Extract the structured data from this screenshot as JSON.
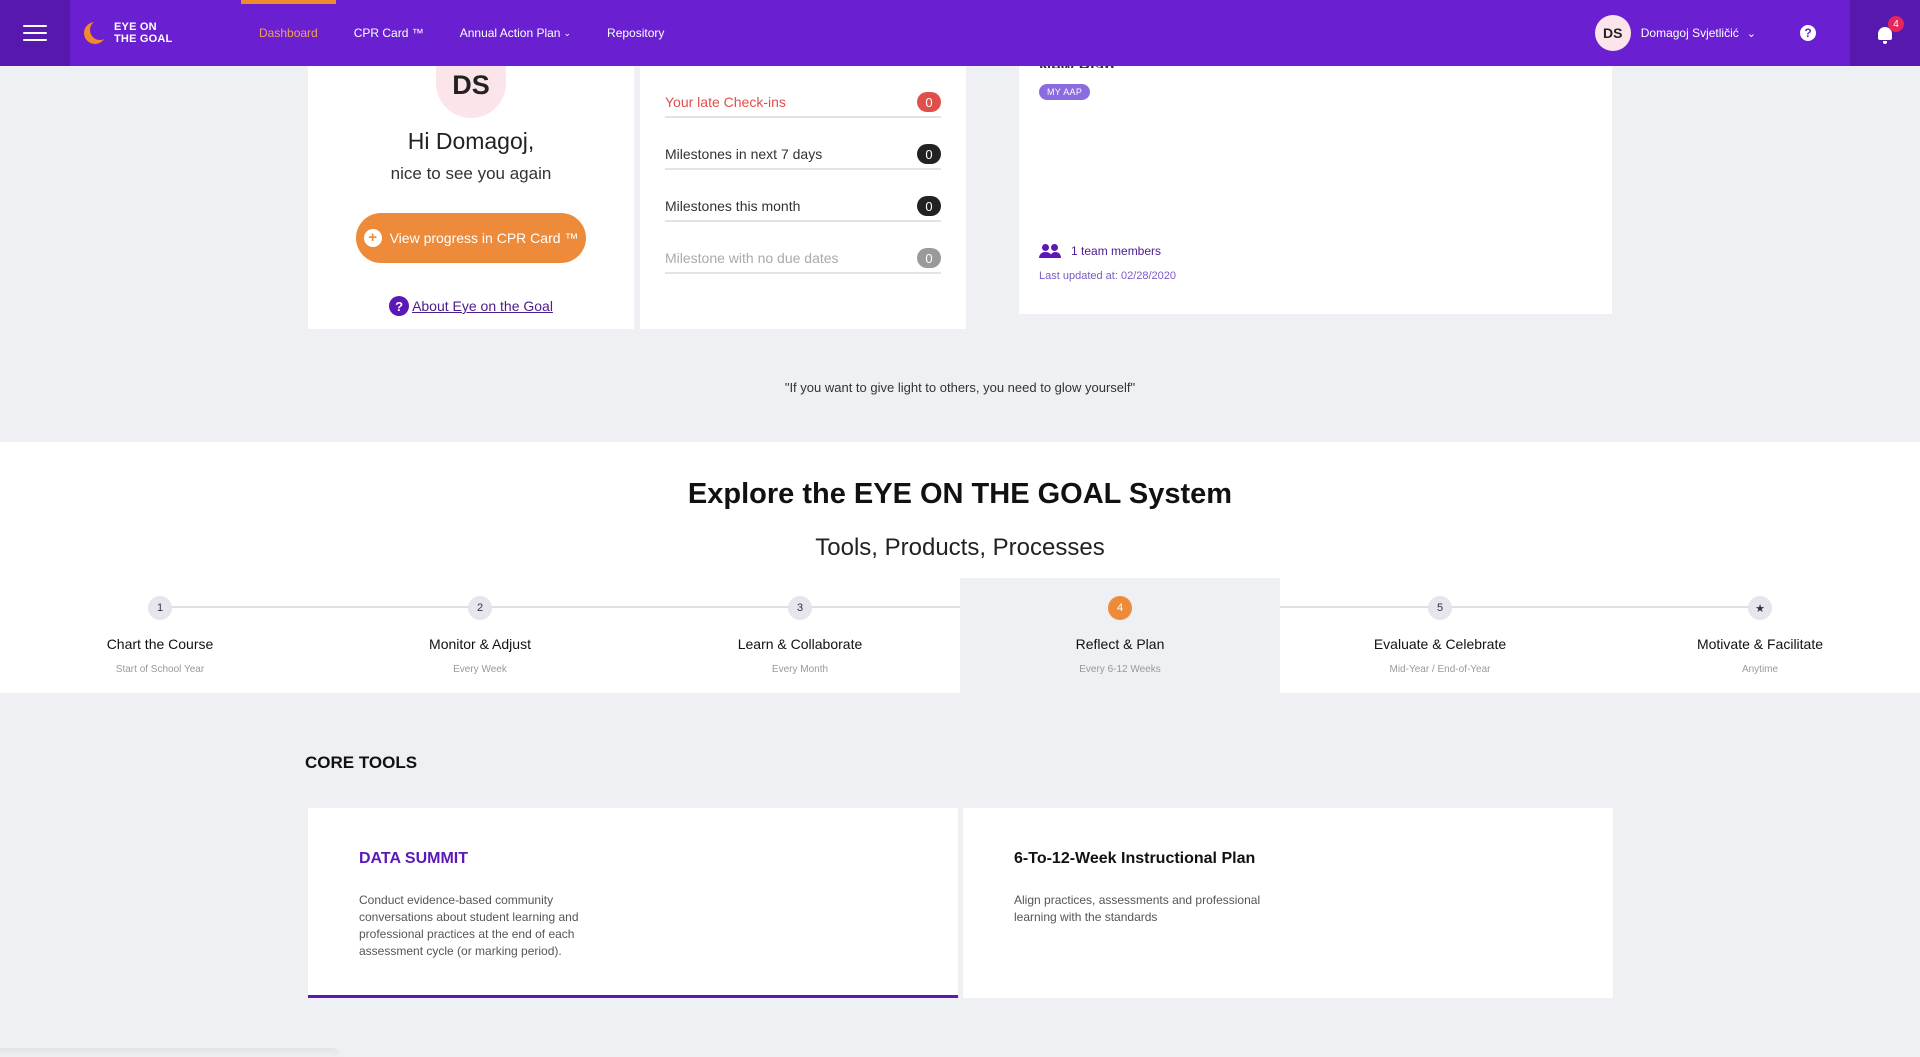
{
  "app": {
    "logo_line1": "EYE ON",
    "logo_line2": "THE GOAL"
  },
  "nav": {
    "items": [
      {
        "label": "Dashboard",
        "dropdown": false
      },
      {
        "label": "CPR Card ™",
        "dropdown": false
      },
      {
        "label": "Annual Action Plan",
        "dropdown": true
      },
      {
        "label": "Repository",
        "dropdown": false
      }
    ],
    "user_initials": "DS",
    "user_name": "Domagoj Svjetličić",
    "notification_count": "4"
  },
  "profile": {
    "initials": "DS",
    "greeting": "Hi Domagoj,",
    "greeting_sub": "nice to see you again",
    "cpr_button_label": "View progress in CPR Card ™",
    "about_link": "About Eye on the Goal"
  },
  "milestones": [
    {
      "label": "Your late Check-ins",
      "count": "0"
    },
    {
      "label": "Milestones in next 7 days",
      "count": "0"
    },
    {
      "label": "Milestones this month",
      "count": "0"
    },
    {
      "label": "Milestone with no due dates",
      "count": "0"
    }
  ],
  "plan": {
    "title": "New Plan",
    "tag": "MY AAP",
    "team_members": "1 team members",
    "last_updated": "Last updated at: 02/28/2020"
  },
  "quote": "\"If you want to give light to others, you need to glow yourself\"",
  "explore": {
    "title": "Explore the EYE ON THE GOAL System",
    "subtitle": "Tools, Products, Processes",
    "steps": [
      {
        "marker": "1",
        "name": "Chart the Course",
        "when": "Start of School Year"
      },
      {
        "marker": "2",
        "name": "Monitor & Adjust",
        "when": "Every Week"
      },
      {
        "marker": "3",
        "name": "Learn & Collaborate",
        "when": "Every Month"
      },
      {
        "marker": "4",
        "name": "Reflect & Plan",
        "when": "Every 6-12 Weeks"
      },
      {
        "marker": "5",
        "name": "Evaluate & Celebrate",
        "when": "Mid-Year / End-of-Year"
      },
      {
        "marker": "★",
        "name": "Motivate & Facilitate",
        "when": "Anytime"
      }
    ],
    "active_step": 4
  },
  "core_tools": {
    "heading": "CORE TOOLS",
    "tools": [
      {
        "title": "DATA SUMMIT",
        "description": "Conduct evidence-based community conversations about student learning and professional practices at the end of each assessment cycle (or marking period)."
      },
      {
        "title": "6-To-12-Week Instructional Plan",
        "description": "Align practices, assessments and professional learning with the standards"
      }
    ]
  },
  "colors": {
    "brand_purple": "#6a1fd0",
    "accent_orange": "#ed8b3a",
    "alert_red": "#e0504b"
  }
}
